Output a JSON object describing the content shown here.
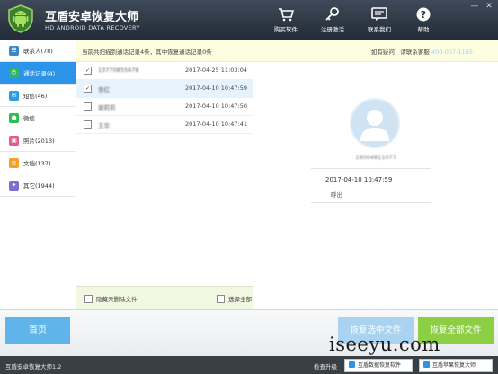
{
  "header": {
    "title": "互盾安卓恢复大师",
    "subtitle": "HD ANDROID DATA RECOVERY",
    "nav": [
      {
        "label": "购买软件",
        "icon": "cart-icon"
      },
      {
        "label": "注册激活",
        "icon": "key-icon"
      },
      {
        "label": "联系我们",
        "icon": "chat-icon"
      },
      {
        "label": "帮助",
        "icon": "help-icon"
      }
    ],
    "window_controls": {
      "minimize": "—",
      "close": "✕"
    }
  },
  "sidebar": {
    "items": [
      {
        "label": "联系人(78)",
        "icon": "contacts-icon",
        "color": "#3d86c6"
      },
      {
        "label": "通话记录(4)",
        "icon": "phone-icon",
        "color": "#2fb36a"
      },
      {
        "label": "短信(46)",
        "icon": "sms-icon",
        "color": "#2c9be6"
      },
      {
        "label": "微信",
        "icon": "wechat-icon",
        "color": "#2fbf4f"
      },
      {
        "label": "照片(2013)",
        "icon": "photo-icon",
        "color": "#e45b8a"
      },
      {
        "label": "文档(137)",
        "icon": "document-icon",
        "color": "#f1a227"
      },
      {
        "label": "其它(1944)",
        "icon": "other-icon",
        "color": "#7b6fd0"
      }
    ],
    "active_index": 1
  },
  "topbar": {
    "left_text": "当前共扫描到通话记录4条，其中恢复通话记录0条",
    "right_text": "如有疑问，请联系客服",
    "phone": "400-007-1165"
  },
  "list": {
    "rows": [
      {
        "name": "13770855678",
        "time": "2017-04-25 11:03:04",
        "checked": true,
        "selected": false
      },
      {
        "name": "李红",
        "time": "2017-04-10 10:47:59",
        "checked": true,
        "selected": true
      },
      {
        "name": "谢莉莉",
        "time": "2017-04-10 10:47:50",
        "checked": false,
        "selected": false
      },
      {
        "name": "王华",
        "time": "2017-04-10 10:47:41",
        "checked": false,
        "selected": false
      }
    ],
    "footer": {
      "hide_deleted": "隐藏未删除文件",
      "select_all": "选择全部"
    }
  },
  "detail": {
    "contact_number": "18004811077",
    "time": "2017-04-10 10:47:59",
    "call_type": "呼出"
  },
  "bottom": {
    "home": "首页",
    "recover_selected": "恢复选中文件",
    "recover_all": "恢复全部文件",
    "watermark": "iseeyu.com"
  },
  "status": {
    "version": "互盾安卓恢复大师1.2",
    "update": "检查升级",
    "btn1": "互盾数据恢复软件",
    "btn2": "互盾苹果恢复大师"
  }
}
